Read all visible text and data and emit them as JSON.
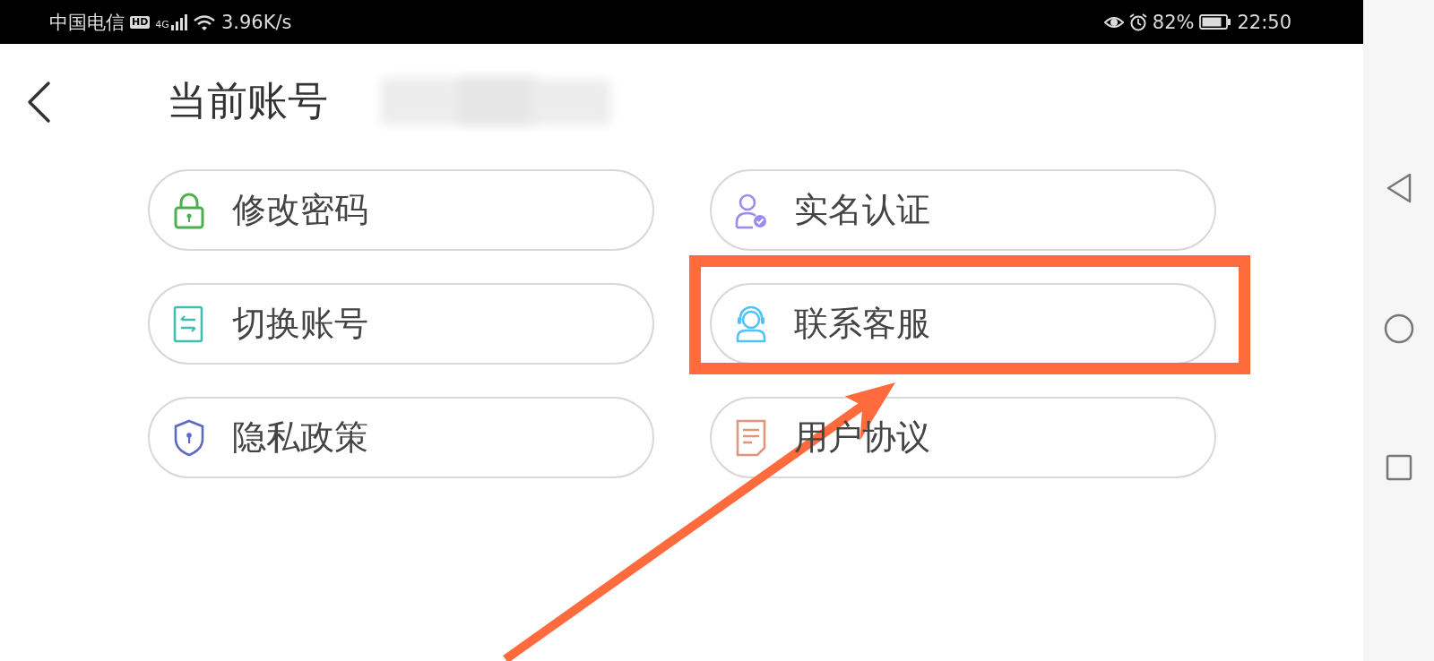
{
  "status_bar": {
    "carrier": "中国电信",
    "hd_badge": "HD",
    "network_type": "4G",
    "network_speed": "3.96K/s",
    "battery_percent": "82%",
    "time": "22:50"
  },
  "header": {
    "title": "当前账号"
  },
  "menu_items": [
    {
      "label": "修改密码",
      "kind": "lock",
      "highlighted": false
    },
    {
      "label": "实名认证",
      "kind": "person",
      "highlighted": false
    },
    {
      "label": "切换账号",
      "kind": "switch",
      "highlighted": false
    },
    {
      "label": "联系客服",
      "kind": "headset",
      "highlighted": true
    },
    {
      "label": "隐私政策",
      "kind": "shield",
      "highlighted": false
    },
    {
      "label": "用户协议",
      "kind": "document",
      "highlighted": false
    }
  ]
}
